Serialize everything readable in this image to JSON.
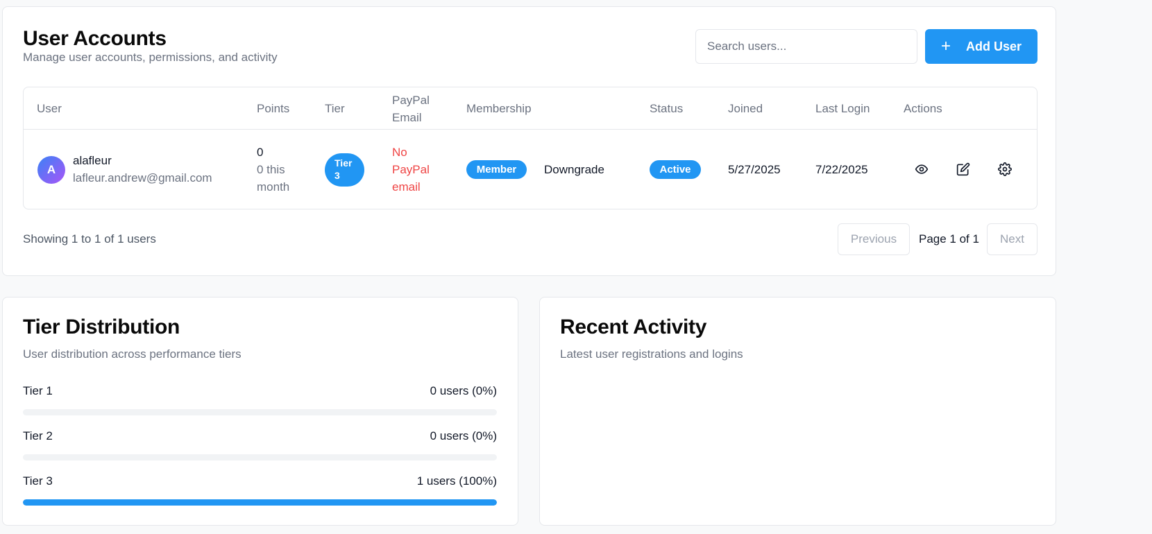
{
  "accounts": {
    "title": "User Accounts",
    "subtitle": "Manage user accounts, permissions, and activity",
    "search_placeholder": "Search users...",
    "add_user_label": "Add User",
    "table": {
      "headers": {
        "user": "User",
        "points": "Points",
        "tier": "Tier",
        "paypal_line1": "PayPal",
        "paypal_line2": "Email",
        "membership": "Membership",
        "status": "Status",
        "joined": "Joined",
        "last_login": "Last Login",
        "actions": "Actions"
      },
      "rows": [
        {
          "avatar_initial": "A",
          "username": "alafleur",
          "email": "lafleur.andrew@gmail.com",
          "points": "0",
          "points_month_line1": "0 this",
          "points_month_line2": "month",
          "tier_line1": "Tier",
          "tier_line2": "3",
          "paypal_line1": "No",
          "paypal_line2": "PayPal",
          "paypal_line3": "email",
          "membership_badge": "Member",
          "membership_action": "Downgrade",
          "status": "Active",
          "joined": "5/27/2025",
          "last_login": "7/22/2025",
          "actions": [
            "eye-icon",
            "edit-icon",
            "gear-icon"
          ]
        }
      ]
    },
    "pagination": {
      "showing": "Showing 1 to 1 of 1 users",
      "previous": "Previous",
      "page": "Page 1 of 1",
      "next": "Next"
    }
  },
  "tier_distribution": {
    "title": "Tier Distribution",
    "subtitle": "User distribution across performance tiers",
    "tiers": [
      {
        "name": "Tier 1",
        "count_label": "0 users (0%)",
        "fraction": 0
      },
      {
        "name": "Tier 2",
        "count_label": "0 users (0%)",
        "fraction": 0
      },
      {
        "name": "Tier 3",
        "count_label": "1 users (100%)",
        "fraction": 1
      }
    ]
  },
  "recent_activity": {
    "title": "Recent Activity",
    "subtitle": "Latest user registrations and logins"
  },
  "colors": {
    "accent": "#2196f3",
    "danger": "#ef4444",
    "muted": "#6b7280"
  }
}
